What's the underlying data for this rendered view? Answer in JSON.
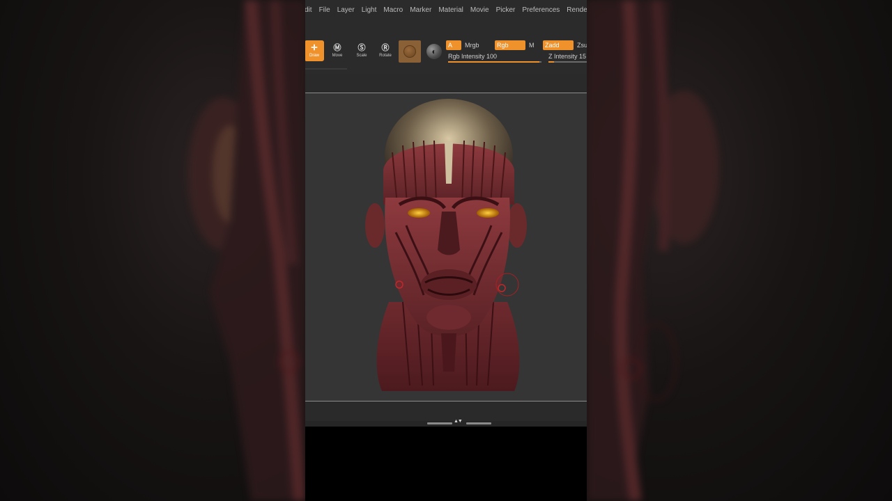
{
  "menu": {
    "items": [
      "dit",
      "File",
      "Layer",
      "Light",
      "Macro",
      "Marker",
      "Material",
      "Movie",
      "Picker",
      "Preferences",
      "Render"
    ]
  },
  "toolbar": {
    "tools": [
      {
        "label": "Draw",
        "icon": "draw-icon",
        "active": true
      },
      {
        "label": "Move",
        "icon": "move-icon",
        "active": false
      },
      {
        "label": "Scale",
        "icon": "scale-icon",
        "active": false
      },
      {
        "label": "Rotate",
        "icon": "rotate-icon",
        "active": false
      }
    ],
    "a_label": "A",
    "mrgb_label": "Mrgb",
    "rgb_label": "Rgb",
    "m_label": "M",
    "zadd_label": "Zadd",
    "zsub_label": "Zsu",
    "rgb_intensity_label": "Rgb Intensity",
    "rgb_intensity_value": "100",
    "z_intensity_label": "Z Intensity",
    "z_intensity_value": "15",
    "rgb_intensity_fill": 0.98,
    "z_intensity_fill": 0.15
  },
  "colors": {
    "accent": "#f0922c",
    "panel": "#2b2b2b",
    "viewport": "#353535",
    "sculpt": "#6e2a2e"
  }
}
